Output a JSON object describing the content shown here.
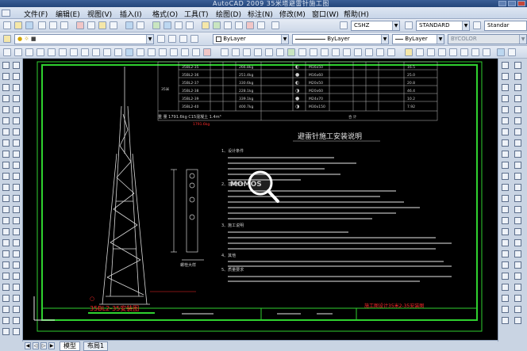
{
  "window": {
    "title": "AutoCAD 2009  35米塔避雷针施工图"
  },
  "menu": {
    "items": [
      "文件(F)",
      "编辑(E)",
      "视图(V)",
      "插入(I)",
      "格式(O)",
      "工具(T)",
      "绘图(D)",
      "标注(N)",
      "修改(M)",
      "窗口(W)",
      "帮助(H)"
    ]
  },
  "properties": {
    "color": "ByLayer",
    "linetype": "ByLayer",
    "lineweight": "ByLayer",
    "plotstyle": "BYCOLOR"
  },
  "styles": {
    "text_style": "CSHZ",
    "dim_style": "STANDARD",
    "table_style": "Standar"
  },
  "drawing": {
    "tower_caption": "35BL2-35安装图",
    "section_label": "螺栓大样",
    "install_title": "避雷针施工安装说明",
    "total_label": "合   计",
    "weight_row": "重 量  1791.6kg  C15混凝土   1.4m³",
    "titleblock_right": "施工图设计35米2-35安装图",
    "note_items": [
      "1、设计条件",
      "2、基础部分",
      "3、施工说明",
      "4、其他",
      "5、质量要求"
    ],
    "watermark": "MOMOS"
  },
  "tabs": {
    "items": [
      "模型",
      "布局1"
    ]
  },
  "colors": {
    "accent": "#ff2a2a",
    "green": "#2fd12f",
    "background": "#000000"
  }
}
